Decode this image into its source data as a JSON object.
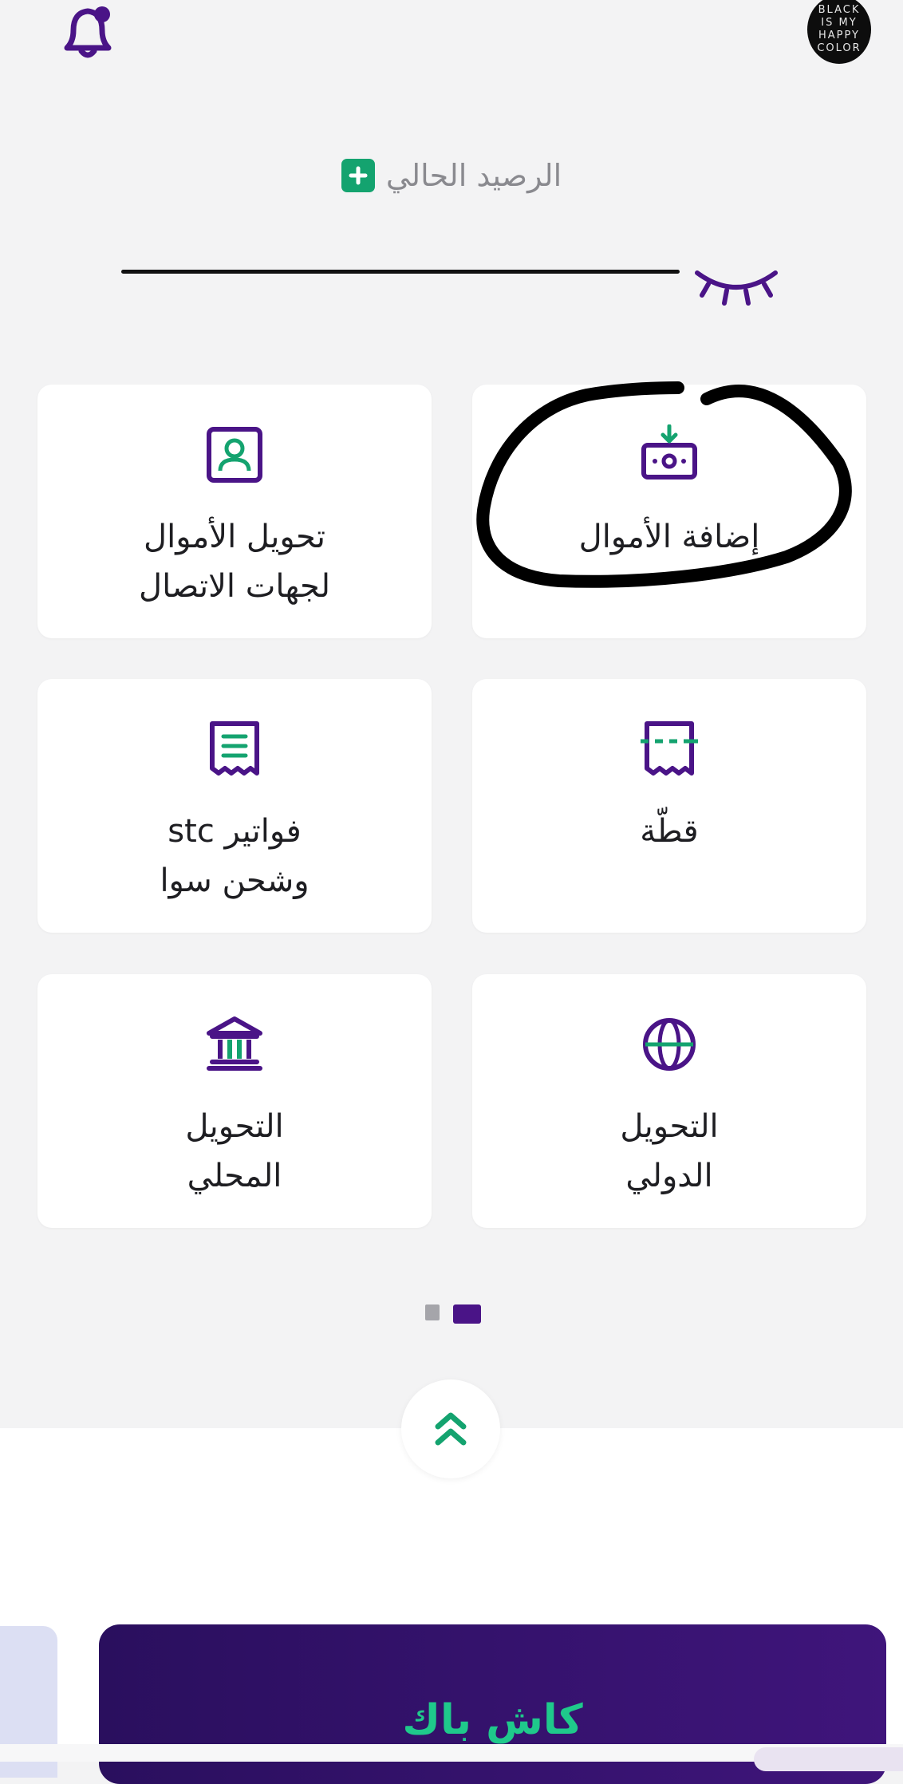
{
  "header": {
    "notification_icon": "bell-icon",
    "avatar_text": [
      "BLACK",
      "IS MY",
      "HAPPY",
      "COLOR"
    ]
  },
  "balance": {
    "label": "الرصيد الحالي",
    "add_icon": "plus-icon",
    "visibility_icon": "closed-eye-icon"
  },
  "services": [
    {
      "label": "إضافة الأموال",
      "icon": "add-money-icon"
    },
    {
      "label": "تحويل الأموال\nلجهات الاتصال",
      "icon": "contact-icon"
    },
    {
      "label": "قطّة",
      "icon": "split-bill-icon"
    },
    {
      "label": "فواتير stc\nوشحن سوا",
      "icon": "receipt-icon"
    },
    {
      "label": "التحويل\nالدولي",
      "icon": "globe-icon"
    },
    {
      "label": "التحويل\nالمحلي",
      "icon": "bank-icon"
    }
  ],
  "pager": {
    "pages": 2,
    "active": 2
  },
  "expand_icon": "double-chevron-up-icon",
  "promo": {
    "title": "كاش باك"
  },
  "colors": {
    "purple": "#4a1487",
    "green": "#14a36f",
    "background": "#f3f3f4"
  }
}
